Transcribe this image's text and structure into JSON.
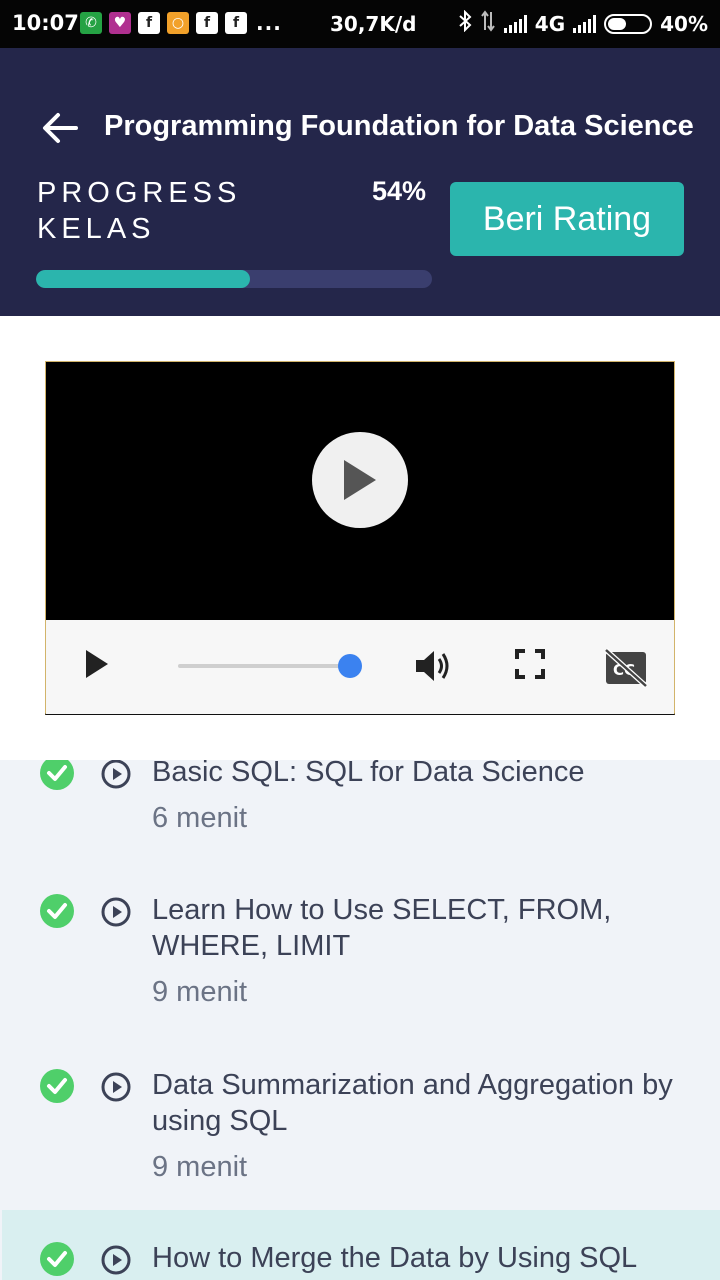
{
  "status_bar": {
    "time": "10:07",
    "speed": "30,7K/d",
    "network": "4G",
    "battery": "40%",
    "more": "..."
  },
  "header": {
    "title": "Programming Foundation for Data Science",
    "progress_label": "PROGRESS KELAS",
    "progress_percent_text": "54%",
    "progress_value": 0.54,
    "rating_button": "Beri Rating",
    "colors": {
      "background": "#24264a",
      "accent": "#2bb5ad"
    }
  },
  "player": {
    "state": "paused",
    "seek_position": 1.0,
    "icons": [
      "play-icon",
      "volume-icon",
      "fullscreen-icon",
      "captions-off-icon"
    ]
  },
  "lessons": [
    {
      "title": "Basic SQL: SQL for Data Science",
      "duration": "6 menit",
      "completed": true
    },
    {
      "title": "Learn How to Use SELECT, FROM, WHERE, LIMIT",
      "duration": "9 menit",
      "completed": true
    },
    {
      "title": "Data Summarization and Aggregation by using SQL",
      "duration": "9 menit",
      "completed": true
    },
    {
      "title": "How to Merge the Data by Using SQL",
      "duration": "",
      "completed": true,
      "active": true
    }
  ]
}
